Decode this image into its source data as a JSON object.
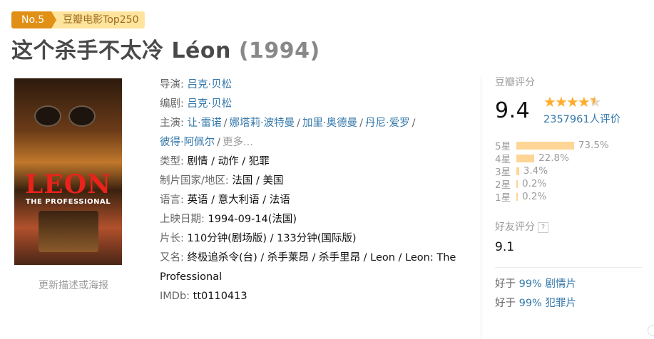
{
  "rank": {
    "no": "No.5",
    "list": "豆瓣电影Top250"
  },
  "title": {
    "name": "这个杀手不太冷 Léon",
    "year": "(1994)"
  },
  "poster": {
    "logo": "LEON",
    "subtitle": "THE PROFESSIONAL",
    "update_link": "更新描述或海报"
  },
  "info": {
    "director": {
      "label": "导演:",
      "names": [
        "吕克·贝松"
      ]
    },
    "writer": {
      "label": "编剧:",
      "names": [
        "吕克·贝松"
      ]
    },
    "cast": {
      "label": "主演:",
      "names": [
        "让·雷诺",
        "娜塔莉·波特曼",
        "加里·奥德曼",
        "丹尼·爱罗",
        "彼得·阿佩尔"
      ],
      "more": "更多..."
    },
    "genre": {
      "label": "类型:",
      "value": "剧情 / 动作 / 犯罪"
    },
    "country": {
      "label": "制片国家/地区:",
      "value": "法国 / 美国"
    },
    "language": {
      "label": "语言:",
      "value": "英语 / 意大利语 / 法语"
    },
    "release": {
      "label": "上映日期:",
      "value": "1994-09-14(法国)"
    },
    "runtime": {
      "label": "片长:",
      "value": "110分钟(剧场版) / 133分钟(国际版)"
    },
    "aka": {
      "label": "又名:",
      "value": "终极追杀令(台) / 杀手莱昂 / 杀手里昂 / Leon / Leon: The Professional"
    },
    "imdb": {
      "label": "IMDb:",
      "value": "tt0110413"
    }
  },
  "rating": {
    "label": "豆瓣评分",
    "score": "9.4",
    "stars": 4.5,
    "votes": "2357961人评价",
    "distribution": [
      {
        "star": "5星",
        "percent": 73.5,
        "label": "73.5%"
      },
      {
        "star": "4星",
        "percent": 22.8,
        "label": "22.8%"
      },
      {
        "star": "3星",
        "percent": 3.4,
        "label": "3.4%"
      },
      {
        "star": "2星",
        "percent": 0.2,
        "label": "0.2%"
      },
      {
        "star": "1星",
        "percent": 0.2,
        "label": "0.2%"
      }
    ],
    "friend_label": "好友评分",
    "friend_help": "?",
    "friend_score": "9.1",
    "better_than": [
      {
        "prefix": "好于",
        "value": "99%",
        "genre": "剧情片"
      },
      {
        "prefix": "好于",
        "value": "99%",
        "genre": "犯罪片"
      }
    ]
  },
  "colors": {
    "link": "#3377aa",
    "rank_badge": "#e09015",
    "rank_list_bg": "#ffe49e",
    "star": "#ffac2d",
    "bar": "#ffd596"
  }
}
